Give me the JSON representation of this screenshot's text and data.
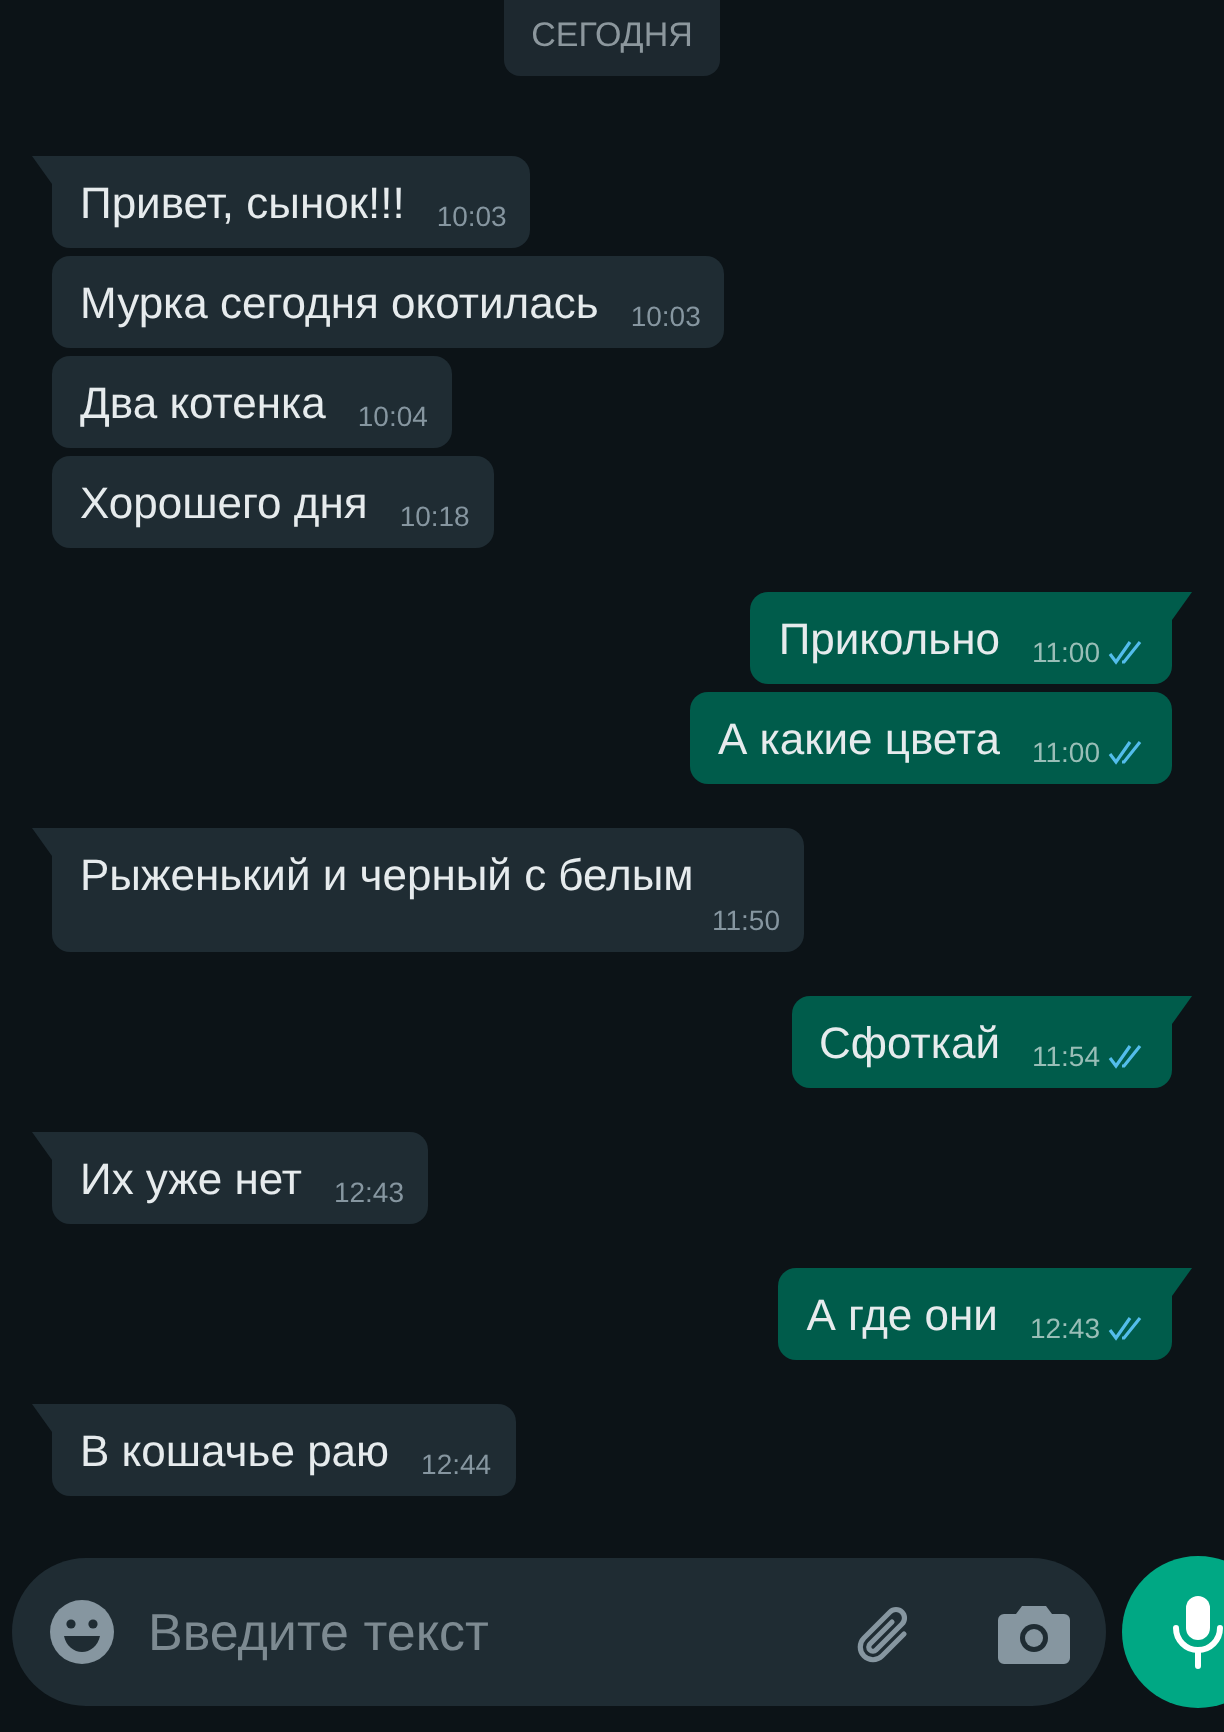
{
  "date_chip": "СЕГОДНЯ",
  "messages": [
    {
      "kind": "incoming",
      "first": true,
      "text": "Привет, сынок!!!",
      "time": "10:03"
    },
    {
      "kind": "incoming",
      "first": false,
      "text": "Мурка сегодня окотилась",
      "time": "10:03"
    },
    {
      "kind": "incoming",
      "first": false,
      "text": "Два котенка",
      "time": "10:04"
    },
    {
      "kind": "incoming",
      "first": false,
      "text": "Хорошего дня",
      "time": "10:18"
    },
    {
      "kind": "outgoing",
      "first": true,
      "text": "Прикольно",
      "time": "11:00",
      "read": true
    },
    {
      "kind": "outgoing",
      "first": false,
      "text": "А какие цвета",
      "time": "11:00",
      "read": true
    },
    {
      "kind": "incoming",
      "first": true,
      "text": "Рыженький и черный с белым",
      "time": "11:50"
    },
    {
      "kind": "outgoing",
      "first": true,
      "text": "Сфоткай",
      "time": "11:54",
      "read": true
    },
    {
      "kind": "incoming",
      "first": true,
      "text": "Их уже нет",
      "time": "12:43"
    },
    {
      "kind": "outgoing",
      "first": true,
      "text": "А где они",
      "time": "12:43",
      "read": true
    },
    {
      "kind": "incoming",
      "first": true,
      "text": "В кошачье раю",
      "time": "12:44"
    }
  ],
  "composer": {
    "placeholder": "Введите текст"
  }
}
